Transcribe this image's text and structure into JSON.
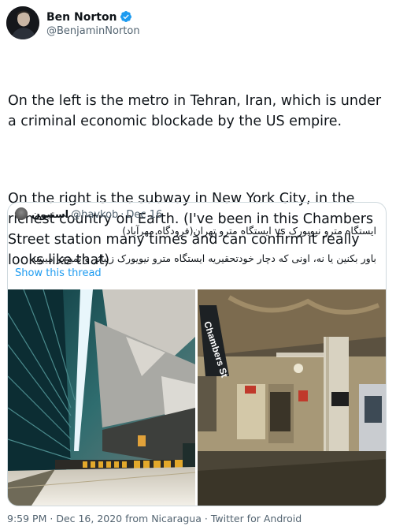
{
  "author": {
    "name": "Ben Norton",
    "handle": "@BenjaminNorton"
  },
  "tweet": {
    "paragraph1": "On the left is the metro in Tehran, Iran, which is under a criminal economic blockade by the US empire.",
    "paragraph2": "On the right is the subway in New York City, in the richest country on Earth. (I've been in this Chambers Street station many times and can confirm it really looks like that)"
  },
  "quoted": {
    "name": "استیون",
    "handle": "@havkob",
    "date": "Dec 16",
    "line1": "ایستگاه مترو نیویورک vs ایستگاه مترو تهران(فرودگاه مهرآباد)",
    "line2": "باور بکنین یا نه، اونی که دچار خودتحقیریه ایستگاه مترو نیویورک زیباتر و تمیزتر میبینه",
    "show_thread": "Show this thread",
    "photo_sign": "Chambers St"
  },
  "meta": {
    "time": "9:59 PM",
    "date": "Dec 16, 2020",
    "from": "from Nicaragua",
    "client": "Twitter for Android"
  },
  "colors": {
    "link": "#1d9bf0",
    "secondary_text": "#536471",
    "border": "#cfd9de"
  }
}
